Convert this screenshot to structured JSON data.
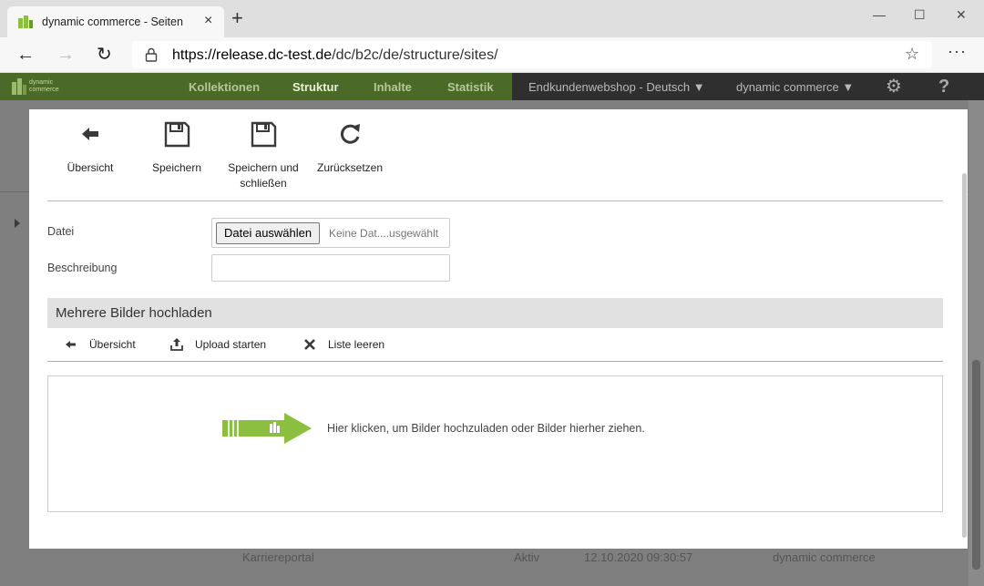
{
  "browser": {
    "tab_title": "dynamic commerce - Seiten",
    "tab_close": "×",
    "new_tab": "+",
    "url_host": "https://release.dc-test.de",
    "url_path": "/dc/b2c/de/structure/sites/",
    "window_controls": [
      "—",
      "☐",
      "✕"
    ],
    "more_menu": "···"
  },
  "app_header": {
    "logo_text_line1": "dynamic",
    "logo_text_line2": "commerce",
    "menu": [
      {
        "label": "Kollektionen",
        "active": false
      },
      {
        "label": "Struktur",
        "active": true
      },
      {
        "label": "Inhalte",
        "active": false
      },
      {
        "label": "Statistik",
        "active": false
      }
    ],
    "shop_selector": "Endkundenwebshop - Deutsch",
    "company_selector": "dynamic commerce",
    "colors": {
      "header_green": "#4b6a28",
      "accent_green": "#8cbf3f"
    }
  },
  "background_row": {
    "name": "Karriereportal",
    "status": "Aktiv",
    "date": "12.10.2020 09:30:57",
    "owner": "dynamic commerce"
  },
  "toolbar": {
    "overview": "Übersicht",
    "save": "Speichern",
    "save_close_line1": "Speichern und",
    "save_close_line2": "schließen",
    "reset": "Zurücksetzen"
  },
  "form": {
    "file_label": "Datei",
    "file_button": "Datei auswählen",
    "file_status": "Keine Dat....usgewählt",
    "description_label": "Beschreibung",
    "description_value": ""
  },
  "multi_upload": {
    "title": "Mehrere Bilder hochladen",
    "overview": "Übersicht",
    "start_upload": "Upload starten",
    "clear_list": "Liste leeren",
    "dropzone_text": "Hier klicken, um Bilder hochzuladen oder Bilder hierher ziehen."
  }
}
